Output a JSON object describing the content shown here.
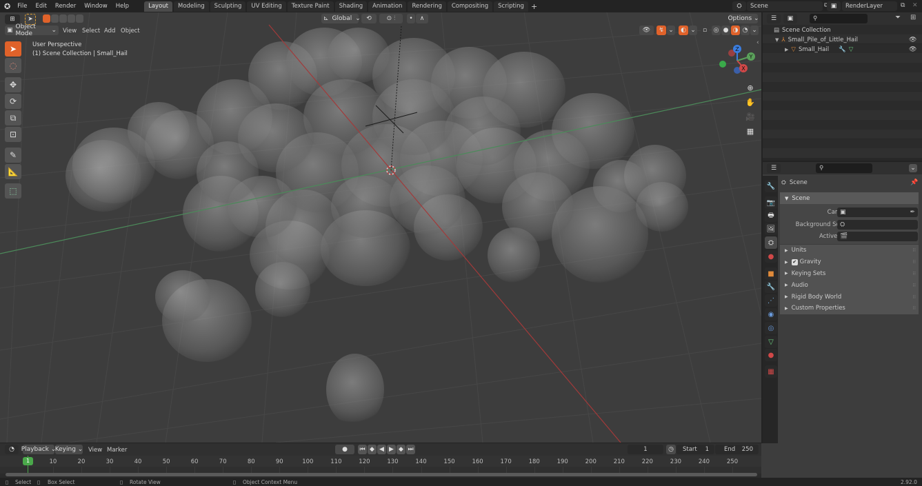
{
  "topbar": {
    "menu": [
      "File",
      "Edit",
      "Render",
      "Window",
      "Help"
    ],
    "workspaces": [
      "Layout",
      "Modeling",
      "Sculpting",
      "UV Editing",
      "Texture Paint",
      "Shading",
      "Animation",
      "Rendering",
      "Compositing",
      "Scripting"
    ],
    "active_workspace": "Layout",
    "add_workspace": "+",
    "scene": "Scene",
    "view_layer": "RenderLayer"
  },
  "viewport": {
    "mode": "Object Mode",
    "menu": [
      "View",
      "Select",
      "Add",
      "Object"
    ],
    "transform_orientation": "Global",
    "options_label": "Options",
    "overlay_title": "User Perspective",
    "overlay_subtitle": "(1) Scene Collection | Small_Hail",
    "gizmo": {
      "z": "Z",
      "y": "Y",
      "x": "X"
    },
    "tools": [
      "select-box",
      "cursor",
      "move",
      "rotate",
      "scale",
      "transform",
      "annotate",
      "measure",
      "add-cube"
    ],
    "nav_buttons": [
      "zoom",
      "pan",
      "camera-view",
      "ortho-toggle"
    ],
    "colors": {
      "x_axis": "#a23a3a",
      "y_axis": "#4c8a5a",
      "accent": "#e0622a"
    }
  },
  "outliner": {
    "search_placeholder": "",
    "root": "Scene Collection",
    "items": [
      {
        "label": "Small_Pile_of_Little_Hail",
        "type": "empty",
        "level": 1,
        "expanded": true
      },
      {
        "label": "Small_Hail",
        "type": "mesh",
        "level": 2,
        "expanded": false
      }
    ]
  },
  "properties": {
    "search_placeholder": "",
    "context": "Scene",
    "panel_title": "Scene",
    "fields": [
      {
        "label": "Camera",
        "value": ""
      },
      {
        "label": "Background Scene",
        "value": ""
      },
      {
        "label": "Active Clip",
        "value": ""
      }
    ],
    "subpanels": [
      "Units",
      "Gravity",
      "Keying Sets",
      "Audio",
      "Rigid Body World",
      "Custom Properties"
    ],
    "gravity_checked": true,
    "tabs": [
      "tool",
      "render",
      "output",
      "view-layer",
      "scene",
      "world",
      "object",
      "modifiers",
      "particles",
      "physics",
      "constraints",
      "data",
      "material",
      "texture"
    ]
  },
  "timeline": {
    "menu": [
      "Playback",
      "Keying",
      "View",
      "Marker"
    ],
    "current_frame": "1",
    "start_label": "Start",
    "start": "1",
    "end_label": "End",
    "end": "250",
    "ticks": [
      "10",
      "20",
      "30",
      "40",
      "50",
      "60",
      "70",
      "80",
      "90",
      "100",
      "110",
      "120",
      "130",
      "140",
      "150",
      "160",
      "170",
      "180",
      "190",
      "200",
      "210",
      "220",
      "230",
      "240",
      "250"
    ],
    "playhead": "1"
  },
  "statusbar": {
    "items": [
      "Select",
      "Box Select",
      "Rotate View",
      "Object Context Menu"
    ],
    "version": "2.92.0"
  }
}
